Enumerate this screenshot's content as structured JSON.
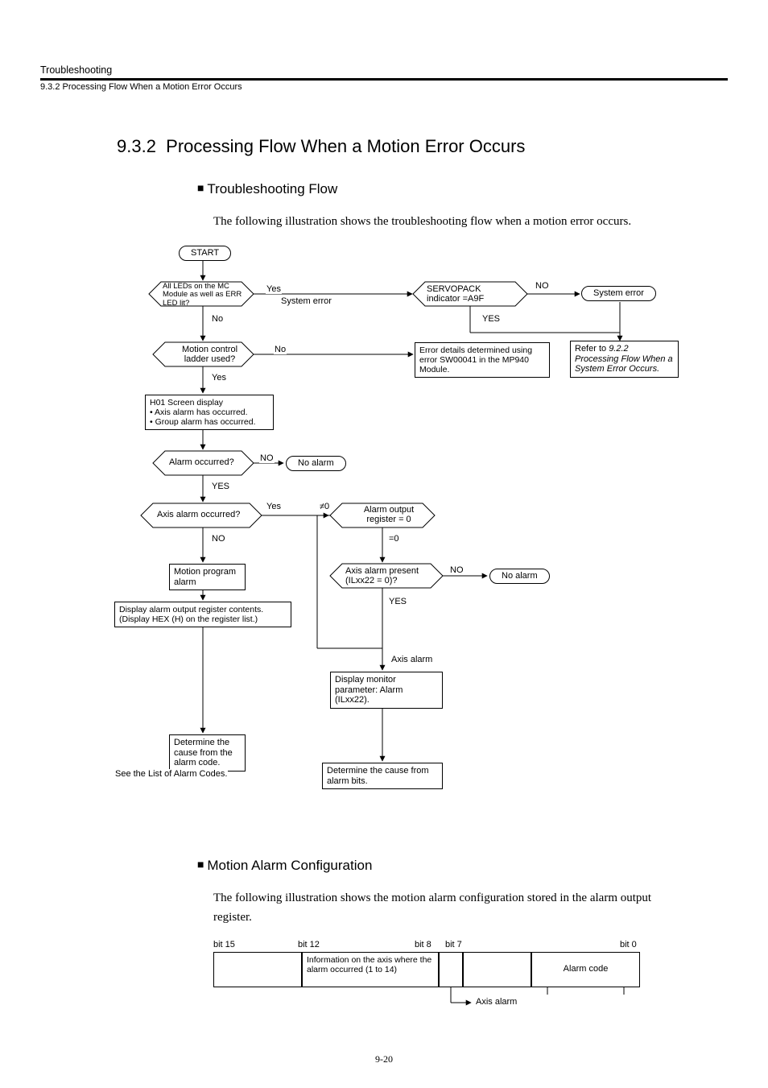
{
  "header": {
    "chapter": "Troubleshooting",
    "subsection": "9.3.2  Processing Flow When a Motion Error Occurs"
  },
  "section": {
    "number": "9.3.2",
    "title": "Processing Flow When a Motion Error Occurs"
  },
  "sub1": {
    "title": "Troubleshooting Flow",
    "intro": "The following illustration shows the troubleshooting flow when a motion error occurs."
  },
  "flow": {
    "start": "START",
    "d_leds": "All LEDs on the MC Module as well as ERR LED lit?",
    "d_leds_yes": "Yes",
    "d_leds_no": "No",
    "sys_err1": "System error",
    "d_servo": "SERVOPACK indicator =A9F",
    "d_servo_yes": "YES",
    "d_servo_no": "NO",
    "sys_err2": "System error",
    "refer": "Refer to 9.2.2 Processing Flow When a System Error Occurs.",
    "d_ladder": "Motion control ladder used?",
    "d_ladder_no": "No",
    "d_ladder_yes": "Yes",
    "err_details": "Error details determined using error SW00041 in the MP940 Module.",
    "h01": "H01 Screen display\n• Axis alarm has occurred.\n• Group alarm has occurred.",
    "d_alarm": "Alarm occurred?",
    "d_alarm_no": "NO",
    "d_alarm_yes": "YES",
    "no_alarm1": "No alarm",
    "d_axis": "Axis alarm occurred?",
    "d_axis_yes": "Yes",
    "d_axis_no": "NO",
    "d_reg": "Alarm output register = 0",
    "d_reg_ne": "≠0",
    "d_reg_eq": "=0",
    "mp_alarm": "Motion program alarm",
    "d_ilxx": "Axis alarm present (ILxx22 = 0)?",
    "d_ilxx_no": "NO",
    "d_ilxx_yes": "YES",
    "no_alarm2": "No alarm",
    "disp_reg": "Display alarm output register contents. (Display HEX (H) on the register list.)",
    "axis_alarm": "Axis alarm",
    "disp_mon": "Display monitor parameter: Alarm (ILxx22).",
    "det_code": "Determine the cause from the alarm code.",
    "see_list": "See the List of Alarm Codes.",
    "det_bits": "Determine the cause from alarm bits."
  },
  "sub2": {
    "title": "Motion Alarm Configuration",
    "intro": "The following illustration shows the motion alarm configuration stored in the alarm output register."
  },
  "bits": {
    "b15": "bit  15",
    "b12": "bit  12",
    "b8": "bit  8",
    "b7": "bit  7",
    "b0": "bit  0",
    "axis_info": "Information on the axis where the alarm occurred (1 to 14)",
    "alarm_code": "Alarm code",
    "axis_alarm": "Axis alarm"
  },
  "pagenum": "9-20"
}
